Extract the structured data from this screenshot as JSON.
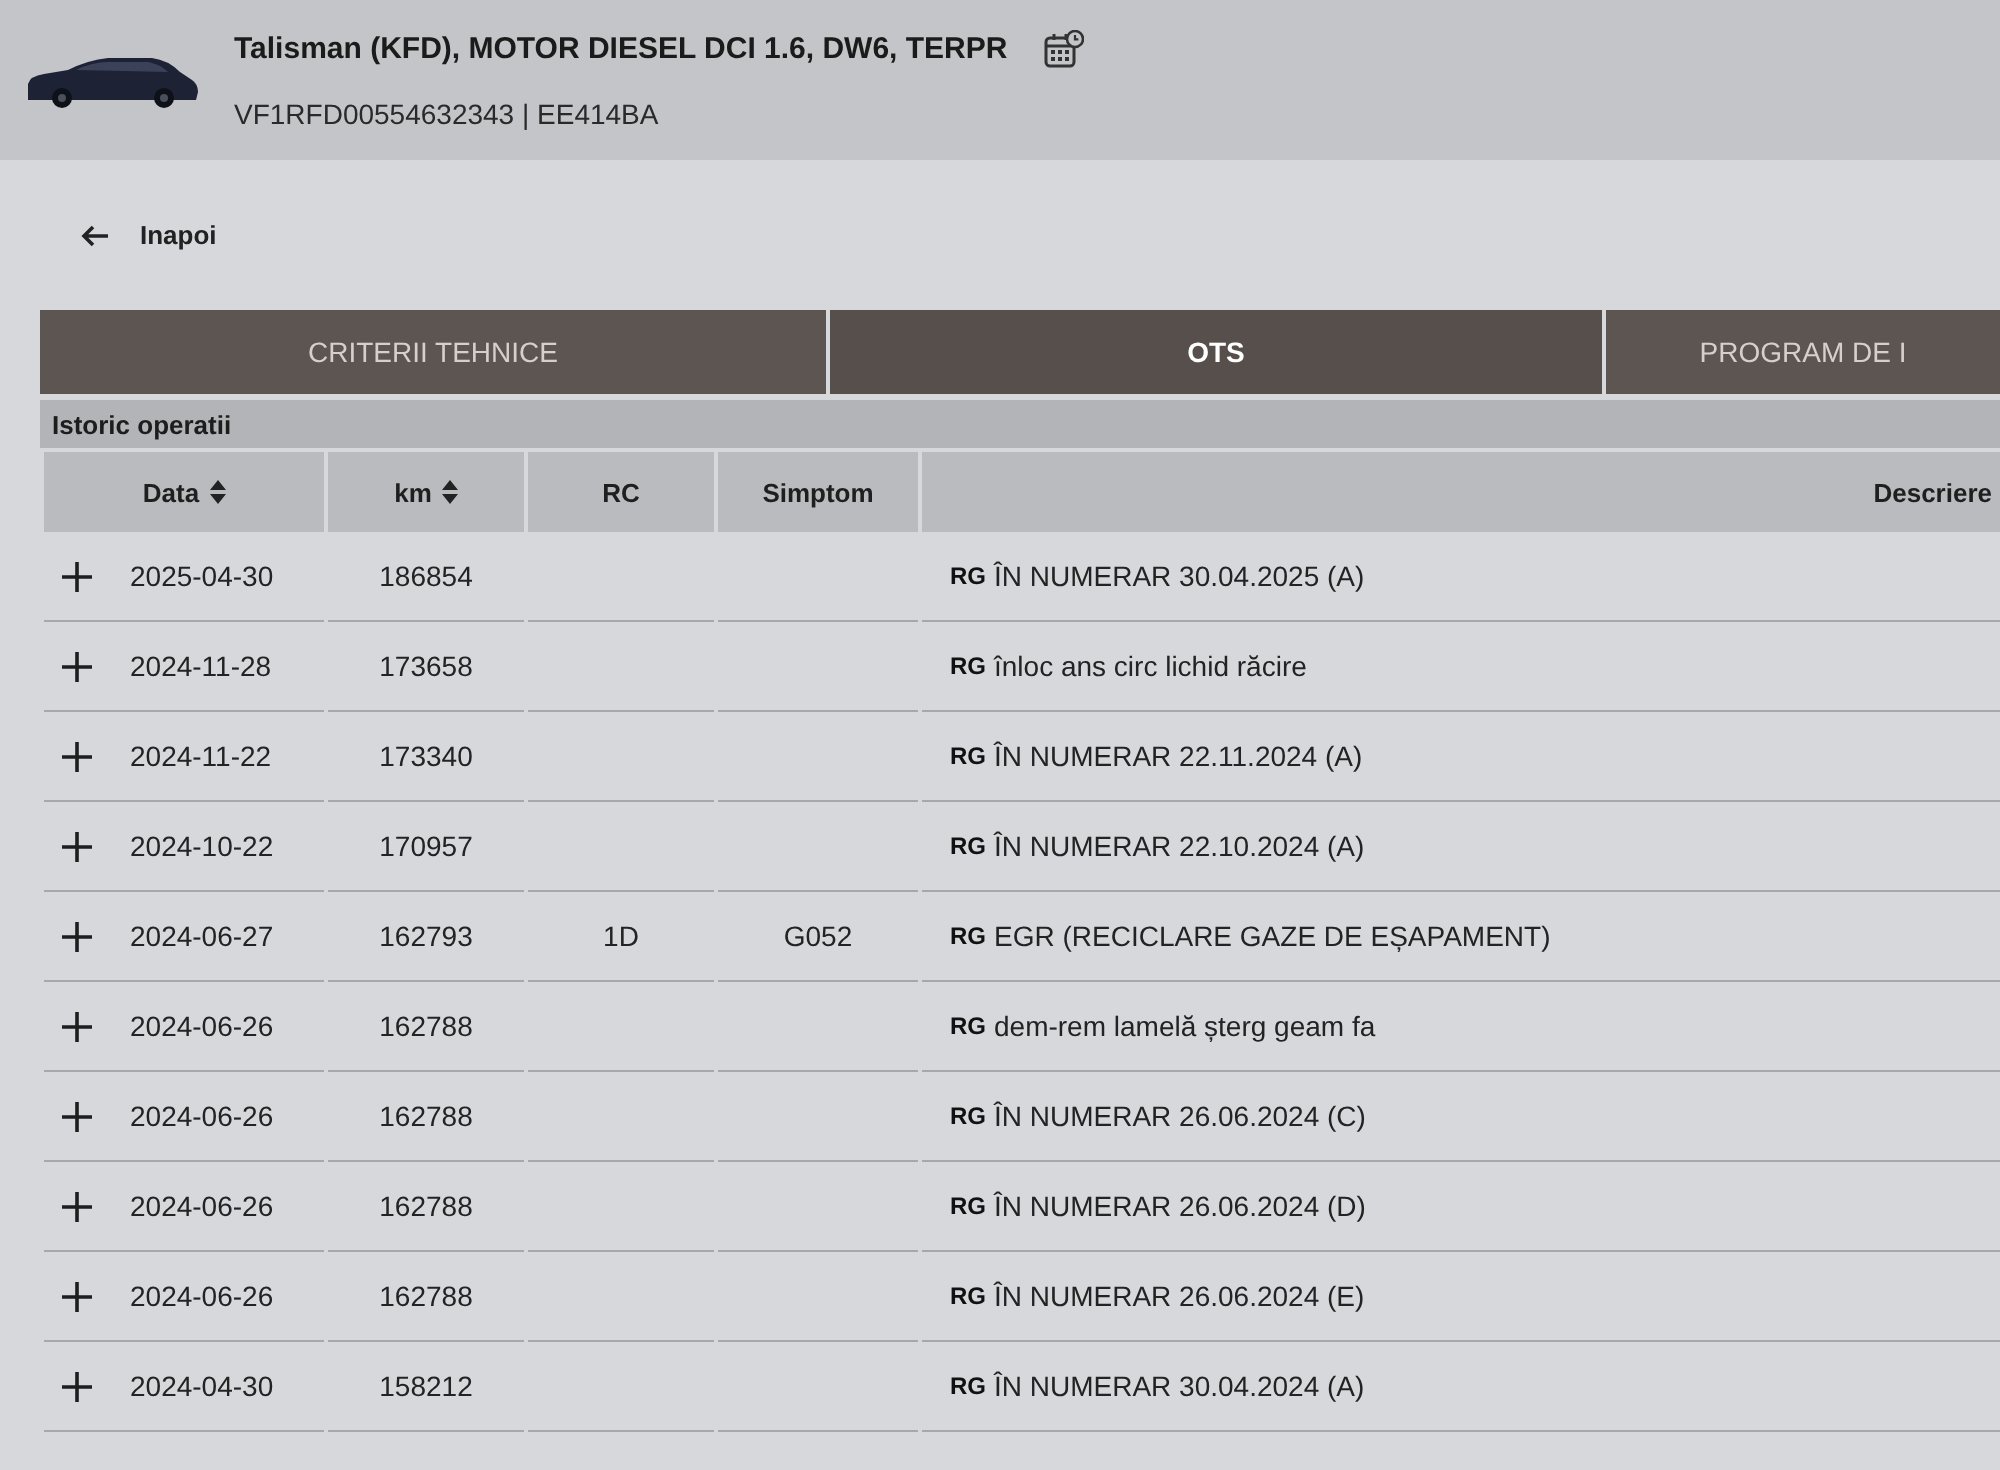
{
  "header": {
    "title": "Talisman (KFD), MOTOR DIESEL DCI 1.6, DW6, TERPR",
    "subtitle": "VF1RFD00554632343 | EE414BA"
  },
  "back_link": {
    "label": "Inapoi"
  },
  "tabs": [
    {
      "label": "CRITERII TEHNICE",
      "selected": false
    },
    {
      "label": "OTS",
      "selected": true
    },
    {
      "label": "PROGRAM DE I",
      "selected": false
    }
  ],
  "history": {
    "title": "Istoric operatii",
    "columns": [
      {
        "label": "Data",
        "sortable": true
      },
      {
        "label": "km",
        "sortable": true
      },
      {
        "label": "RC",
        "sortable": false
      },
      {
        "label": "Simptom",
        "sortable": false
      },
      {
        "label": "Descriere",
        "sortable": false
      }
    ],
    "rows": [
      {
        "expanded": false,
        "date": "2025-04-30",
        "km": "186854",
        "code": "RG",
        "description": "ÎN NUMERAR 30.04.2025 (A)"
      },
      {
        "expanded": false,
        "date": "2024-11-28",
        "km": "173658",
        "code": "RG",
        "description": "înloc ans circ lichid răcire"
      },
      {
        "expanded": false,
        "date": "2024-11-22",
        "km": "173340",
        "code": "RG",
        "description": "ÎN NUMERAR 22.11.2024 (A)"
      },
      {
        "expanded": false,
        "date": "2024-10-22",
        "km": "170957",
        "code": "RG",
        "description": "ÎN NUMERAR 22.10.2024 (A)"
      },
      {
        "expanded": false,
        "date": "2024-06-27",
        "km": "162793",
        "rc": "1D",
        "symptom": "G052",
        "code": "RG",
        "description": "EGR (RECICLARE GAZE DE EȘAPAMENT)"
      },
      {
        "expanded": false,
        "date": "2024-06-26",
        "km": "162788",
        "code": "RG",
        "description": "dem-rem lamelă șterg geam fa"
      },
      {
        "expanded": false,
        "date": "2024-06-26",
        "km": "162788",
        "code": "RG",
        "description": "ÎN NUMERAR 26.06.2024 (C)"
      },
      {
        "expanded": false,
        "date": "2024-06-26",
        "km": "162788",
        "code": "RG",
        "description": "ÎN NUMERAR 26.06.2024 (D)"
      },
      {
        "expanded": false,
        "date": "2024-06-26",
        "km": "162788",
        "code": "RG",
        "description": "ÎN NUMERAR 26.06.2024 (E)"
      },
      {
        "expanded": false,
        "date": "2024-04-30",
        "km": "158212",
        "code": "RG",
        "description": "ÎN NUMERAR 30.04.2024 (A)"
      }
    ]
  }
}
